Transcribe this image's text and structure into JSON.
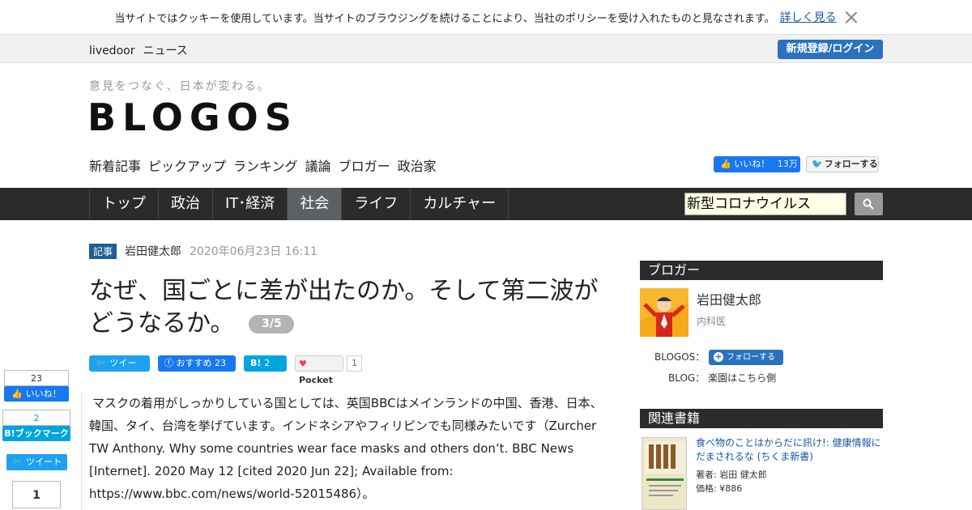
{
  "cookie": {
    "text": "当サイトではクッキーを使用しています。当サイトのブラウジングを続けることにより、当社のポリシーを受け入れたものと見なされます。",
    "more": "詳しく見る"
  },
  "topbar": {
    "brand1": "livedoor",
    "brand2": "ニュース",
    "login": "新規登録/ログイン"
  },
  "header": {
    "tagline": "意見をつなぐ、日本が変わる。",
    "logo": "BLOGOS",
    "subnav": [
      "新着記事",
      "ピックアップ",
      "ランキング",
      "議論",
      "ブロガー",
      "政治家"
    ],
    "fb_like": "いいね！",
    "fb_like_count": "13万",
    "tw_follow": "フォローする"
  },
  "mainnav": {
    "tabs": [
      "トップ",
      "政治",
      "IT･経済",
      "社会",
      "ライフ",
      "カルチャー"
    ],
    "active_index": 3,
    "search_value": "新型コロナウイルス"
  },
  "article": {
    "tag": "記事",
    "author": "岩田健太郎",
    "date": "2020年06月23日 16:11",
    "title": "なぜ、国ごとに差が出たのか。そして第二波がどうなるか。",
    "page": "3/5",
    "share": {
      "tweet": "ツイート",
      "fb": "おすすめ",
      "fb_count": "23",
      "hatena": "B!",
      "hatena_count": "2",
      "pocket": "Pocket",
      "pocket_count": "1"
    },
    "body": "マスクの着用がしっかりしている国としては、英国BBCはメインランドの中国、香港、日本、韓国、タイ、台湾を挙げています。インドネシアやフィリピンでも同様みたいです（Zurcher TW Anthony. Why some countries wear face masks and others don’t. BBC News [Internet]. 2020 May 12 [cited 2020 Jun 22]; Available from: https://www.bbc.com/news/world-52015486）。"
  },
  "floating_share": {
    "fb_count": "23",
    "fb_label": "いいね！",
    "hb_count": "2",
    "hb_label": "B!ブックマーク",
    "tw_label": "ツイート",
    "pocket_count": "1"
  },
  "sidebar": {
    "blogger_head": "ブロガー",
    "blogger_name": "岩田健太郎",
    "blogger_role": "内科医",
    "blogos_label": "BLOGOS：",
    "follow": "フォローする",
    "blog_label": "BLOG：",
    "blog_value": "楽園はこちら側",
    "books_head": "関連書籍",
    "book_title": "食べ物のことはからだに訊け!: 健康情報にだまされるな (ちくま新書)",
    "book_author": "著者: 岩田 健太郎",
    "book_price": "価格: ¥886"
  },
  "colors": {
    "nav_bg": "#2b2b2b",
    "accent_blue": "#2a72c0",
    "facebook": "#1877f2",
    "twitter": "#1da1f2"
  }
}
